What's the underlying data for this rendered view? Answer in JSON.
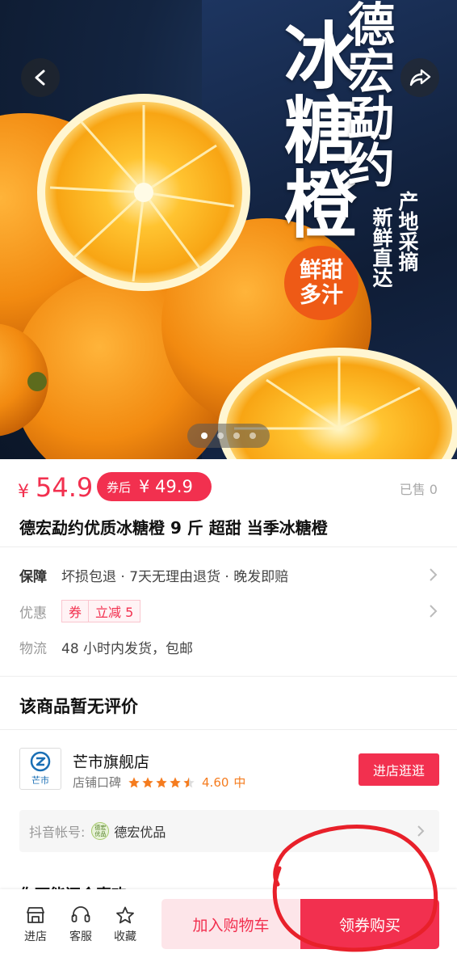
{
  "hero": {
    "brand": "德宏勐约",
    "title": "冰糖橙",
    "sub_line_1": "产地采摘",
    "sub_line_2": "新鲜直达",
    "badge": "鲜甜\n多汁",
    "carousel_count": 4,
    "carousel_active": 1
  },
  "price": {
    "currency": "¥",
    "value": "54.9",
    "coupon_label": "券后",
    "coupon_price": "¥ 49.9",
    "sold": "已售 0"
  },
  "product": {
    "title": "德宏勐约优质冰糖橙 9 斤 超甜 当季冰糖橙"
  },
  "info": {
    "guarantee_label": "保障",
    "guarantee_value": "坏损包退 · 7天无理由退货 · 晚发即赔",
    "promo_label": "优惠",
    "promo_tag": "券",
    "promo_value": "立减 5",
    "shipping_label": "物流",
    "shipping_value": "48 小时内发货，包邮"
  },
  "reviews": {
    "title": "该商品暂无评价"
  },
  "store": {
    "logo_text": "芒市",
    "name": "芒市旗舰店",
    "rating_label": "店铺口碑",
    "rating_stars": 4.5,
    "rating_score": "4.60",
    "rating_level": "中",
    "enter_button": "进店逛逛",
    "account_label": "抖音帐号:",
    "account_icon_text": "德宏优品",
    "account_name": "德宏优品"
  },
  "more_section": {
    "title_partial": "你可能还会喜欢"
  },
  "bottom_bar": {
    "store_label": "进店",
    "service_label": "客服",
    "favorite_label": "收藏",
    "add_cart": "加入购物车",
    "buy": "领券购买"
  },
  "colors": {
    "accent": "#f2304f",
    "orange_badge": "#ee5a16",
    "annotation": "#e8202a"
  }
}
